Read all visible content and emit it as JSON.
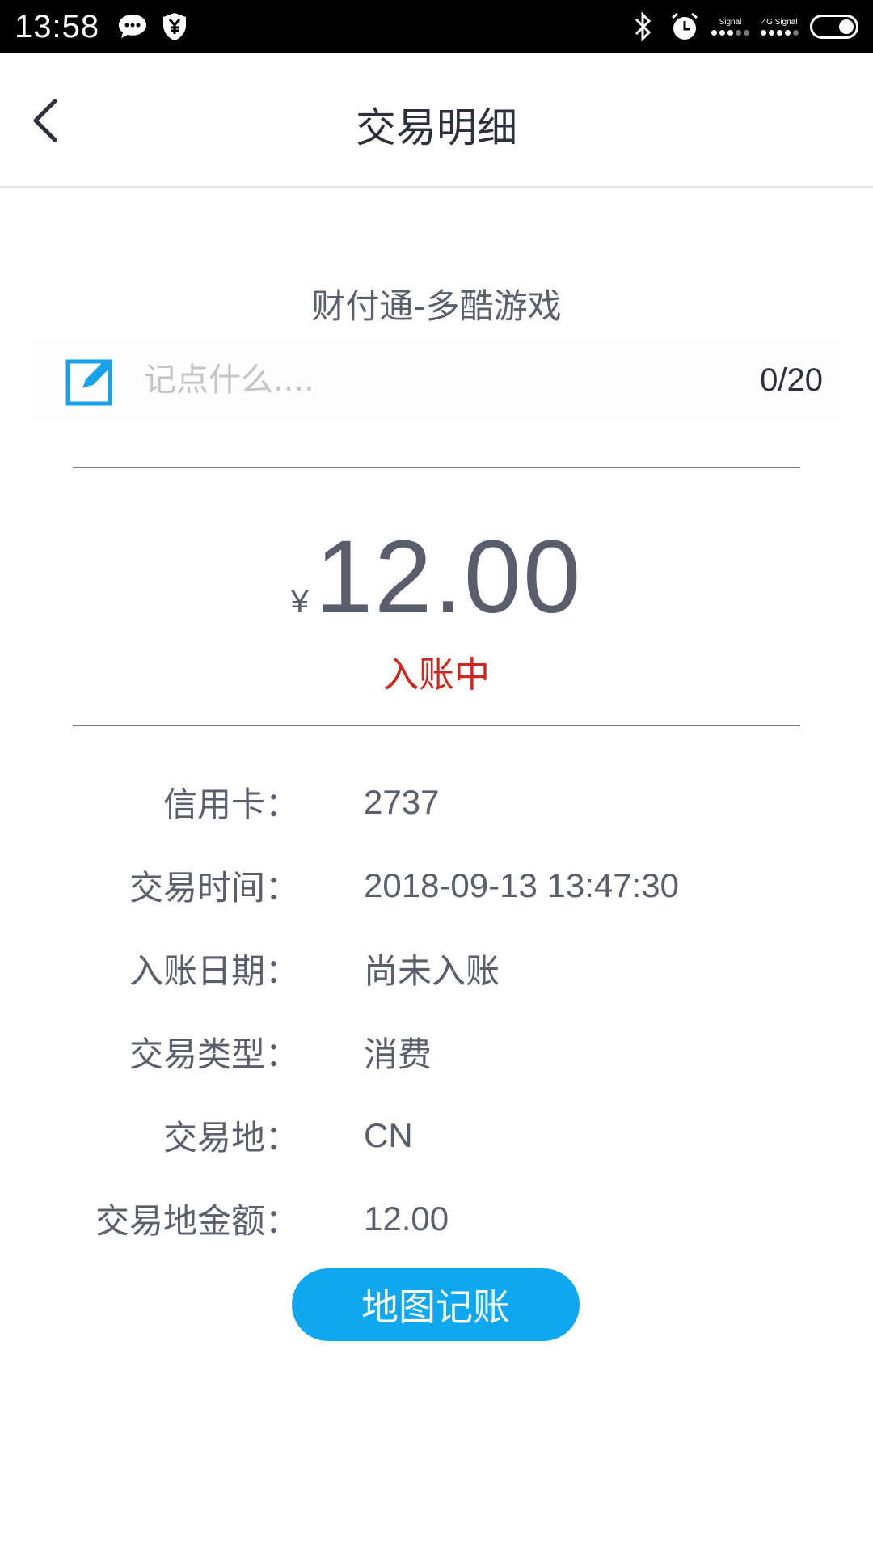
{
  "status_bar": {
    "time": "13:58",
    "signal_label_1": "Signal",
    "signal_label_2": "4G",
    "signal_label_3": "Signal"
  },
  "header": {
    "title": "交易明细"
  },
  "merchant": {
    "name": "财付通-多酷游戏"
  },
  "note": {
    "placeholder": "记点什么....",
    "counter": "0/20"
  },
  "amount": {
    "currency": "¥",
    "value": "12.00",
    "status": "入账中"
  },
  "details": [
    {
      "label": "信用卡：",
      "value": "2737"
    },
    {
      "label": "交易时间：",
      "value": "2018-09-13 13:47:30"
    },
    {
      "label": "入账日期：",
      "value": "尚未入账"
    },
    {
      "label": "交易类型：",
      "value": "消费"
    },
    {
      "label": "交易地：",
      "value": "CN"
    },
    {
      "label": "交易地金额：",
      "value": "12.00"
    }
  ],
  "actions": {
    "map_button_label": "地图记账"
  },
  "colors": {
    "accent": "#0ea7f0",
    "status_red": "#d0281f",
    "text": "#5b5e6b",
    "edit_icon": "#18a3e8"
  }
}
